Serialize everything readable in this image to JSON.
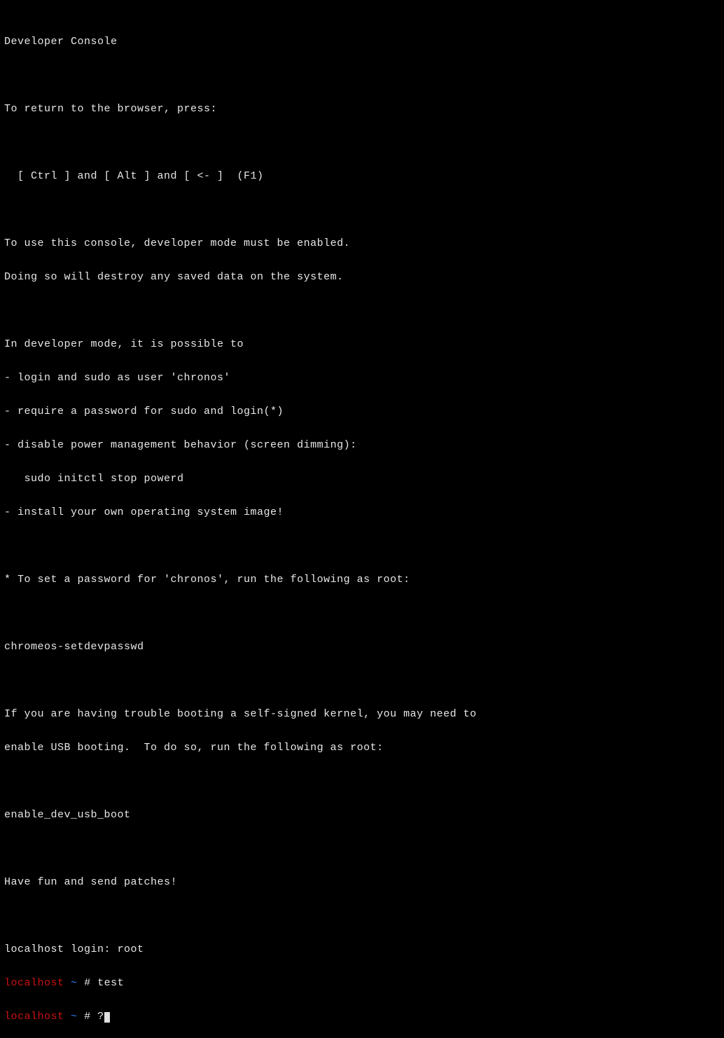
{
  "header": "Developer Console",
  "return_msg": "To return to the browser, press:",
  "return_keys": "  [ Ctrl ] and [ Alt ] and [ <- ]  (F1)",
  "devmode_note1": "To use this console, developer mode must be enabled.",
  "devmode_note2": "Doing so will destroy any saved data on the system.",
  "possible_intro": "In developer mode, it is possible to",
  "possible_item1": "- login and sudo as user 'chronos'",
  "possible_item2": "- require a password for sudo and login(*)",
  "possible_item3": "- disable power management behavior (screen dimming):",
  "possible_item3_cmd": "   sudo initctl stop powerd",
  "possible_item4": "- install your own operating system image!",
  "password_note": "* To set a password for 'chronos', run the following as root:",
  "password_cmd": "chromeos-setdevpasswd",
  "usb_note1": "If you are having trouble booting a self-signed kernel, you may need to",
  "usb_note2": "enable USB booting.  To do so, run the following as root:",
  "usb_cmd": "enable_dev_usb_boot",
  "havefun": "Have fun and send patches!",
  "login_prompt": "localhost login: root",
  "prompt": {
    "hostname": "localhost",
    "path": "~",
    "hash": "#"
  },
  "cmd1": "test",
  "cmd2_char": "?"
}
